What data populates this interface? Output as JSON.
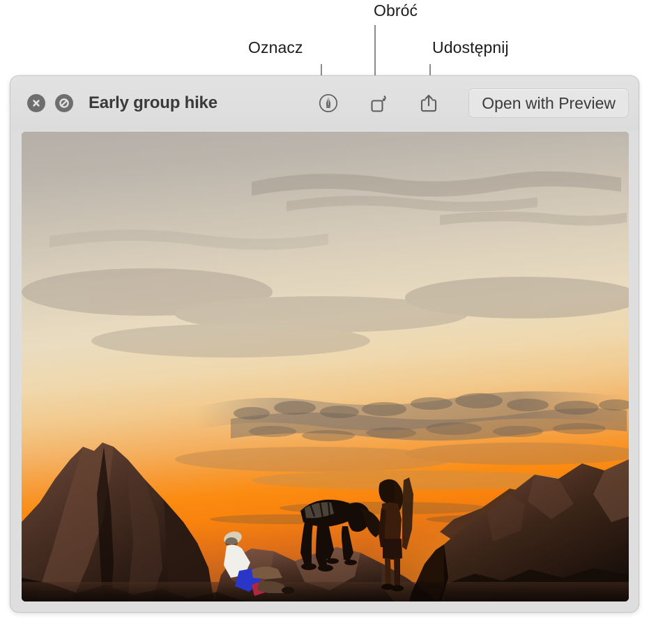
{
  "annotations": [
    {
      "id": "oznacz",
      "label": "Oznacz",
      "target": "markup-button"
    },
    {
      "id": "obroc",
      "label": "Obróć",
      "target": "rotate-button"
    },
    {
      "id": "udostepnij",
      "label": "Udostępnij",
      "target": "share-button"
    }
  ],
  "window": {
    "title": "Early group hike",
    "toolbar": {
      "close_label": "close-icon",
      "mute_label": "no-entry-icon",
      "markup_label": "markup-icon",
      "rotate_label": "rotate-left-icon",
      "share_label": "share-icon",
      "open_with_label": "Open with Preview"
    }
  },
  "photo": {
    "description": "Three hikers silhouetted on sandstone rock formations at sunset",
    "sky_colors": {
      "top": "#b9b3ab",
      "upper_mid": "#cdc3b2",
      "mid": "#e6d8bd",
      "lower_mid": "#efb86a",
      "horizon": "#f79a18",
      "glow": "#ff8c0a"
    },
    "rock_colors": {
      "lit": "#8a6453",
      "mid": "#5a3a2c",
      "shadow": "#2b1a12",
      "deep": "#170d09"
    },
    "figures": [
      {
        "name": "seated-hiker",
        "shirt_color": "#f2f2f0",
        "shorts_color": "#2a36c8"
      },
      {
        "name": "bending-hiker",
        "silhouette_color": "#170d09"
      },
      {
        "name": "standing-hiker",
        "silhouette_color": "#2a1408"
      }
    ]
  },
  "theme": {
    "page_background": "#ffffff",
    "window_background": "#dededf",
    "toolbar_background": "#e0e0e1",
    "button_gray": "#6e6e6e",
    "title_color": "#3a3a3a",
    "callout_color": "#1c1c1c",
    "leader_line_color": "#8a8a8a"
  }
}
